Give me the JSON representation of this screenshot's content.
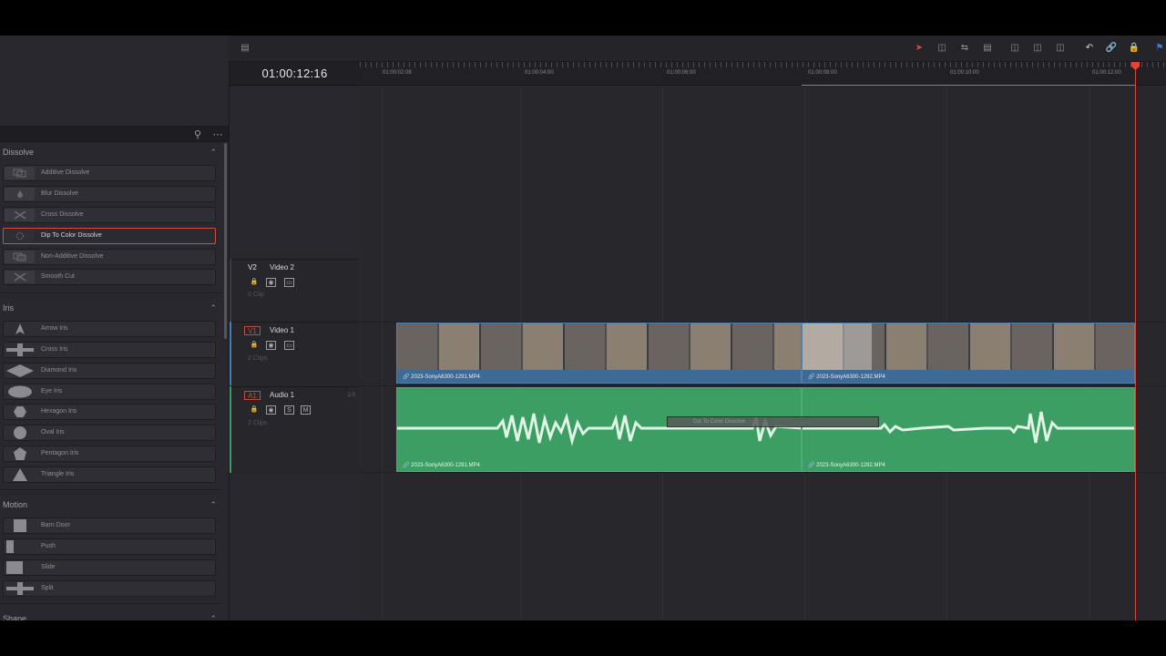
{
  "toolbar": {
    "icons": [
      "timeline-view-icon",
      "selection-arrow-icon",
      "trim-icon",
      "dynamic-trim-icon",
      "blade-icon",
      "insert-clip-icon",
      "overwrite-clip-icon",
      "replace-clip-icon",
      "snapping-icon",
      "linked-selection-icon",
      "lock-icon",
      "flag-icon"
    ]
  },
  "timecode": "01:00:12:16",
  "ruler": {
    "labels": [
      "01:00:02:08",
      "01:00:04:00",
      "01:00:06:00",
      "01:00:08:00",
      "01:00:10:00",
      "01:00:12:00"
    ]
  },
  "effects": {
    "groups": [
      {
        "title": "Dissolve",
        "items": [
          "Additive Dissolve",
          "Blur Dissolve",
          "Cross Dissolve",
          "Dip To Color Dissolve",
          "Non-Additive Dissolve",
          "Smooth Cut"
        ]
      },
      {
        "title": "Iris",
        "items": [
          "Arrow Iris",
          "Cross Iris",
          "Diamond Iris",
          "Eye Iris",
          "Hexagon Iris",
          "Oval Iris",
          "Pentagon Iris",
          "Triangle Iris"
        ]
      },
      {
        "title": "Motion",
        "items": [
          "Barn Door",
          "Push",
          "Slide",
          "Split"
        ]
      },
      {
        "title": "Shape",
        "items": []
      }
    ],
    "selected": "Dip To Color Dissolve"
  },
  "tracks": {
    "v2": {
      "id": "V2",
      "name": "Video 2",
      "clips": "0 Clip"
    },
    "v1": {
      "id": "V1",
      "name": "Video 1",
      "clips": "2 Clips"
    },
    "a1": {
      "id": "A1",
      "name": "Audio 1",
      "clips": "2 Clips",
      "channel": "2.0",
      "solo": "S",
      "mute": "M"
    }
  },
  "clips": {
    "video": [
      "2023-SonyA6300-1291.MP4",
      "2023-SonyA6300-1292.MP4"
    ],
    "audio": [
      "2023-SonyA6300-1291.MP4",
      "2023-SonyA6300-1292.MP4"
    ]
  },
  "transition": {
    "label": "Dip To Color Dissolve"
  },
  "colors": {
    "video_clip": "#3e6a96",
    "audio_clip": "#3c9e62",
    "playhead": "#e0443a",
    "selection": "#d94b3b"
  }
}
